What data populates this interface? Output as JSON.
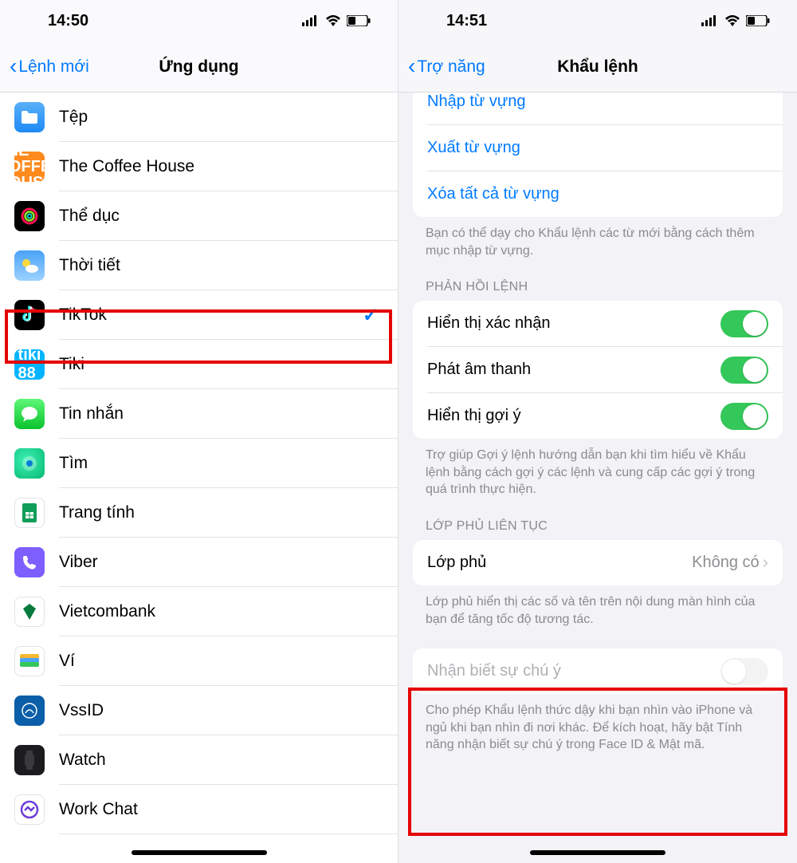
{
  "left": {
    "time": "14:50",
    "back_label": "Lệnh mới",
    "title": "Ứng dụng",
    "apps": [
      {
        "key": "files",
        "label": "Tệp"
      },
      {
        "key": "coffee",
        "label": "The Coffee House"
      },
      {
        "key": "fit",
        "label": "Thể dục"
      },
      {
        "key": "weather",
        "label": "Thời tiết"
      },
      {
        "key": "tiktok",
        "label": "TikTok"
      },
      {
        "key": "tiki",
        "label": "Tiki"
      },
      {
        "key": "msg",
        "label": "Tin nhắn"
      },
      {
        "key": "find",
        "label": "Tìm"
      },
      {
        "key": "sheets",
        "label": "Trang tính"
      },
      {
        "key": "viber",
        "label": "Viber"
      },
      {
        "key": "vcb",
        "label": "Vietcombank"
      },
      {
        "key": "wallet",
        "label": "Ví"
      },
      {
        "key": "vssid",
        "label": "VssID"
      },
      {
        "key": "watch",
        "label": "Watch"
      },
      {
        "key": "workchat",
        "label": "Work Chat"
      }
    ],
    "selected_index": 4
  },
  "right": {
    "time": "14:51",
    "back_label": "Trợ năng",
    "title": "Khẩu lệnh",
    "links": [
      "Nhập từ vựng",
      "Xuất từ vựng",
      "Xóa tất cả từ vựng"
    ],
    "links_footer": "Bạn có thể dạy cho Khẩu lệnh các từ mới bằng cách thêm mục nhập từ vựng.",
    "section_response_header": "PHẢN HỒI LỆNH",
    "toggles": [
      {
        "label": "Hiển thị xác nhận",
        "on": true
      },
      {
        "label": "Phát âm thanh",
        "on": true
      },
      {
        "label": "Hiển thị gợi ý",
        "on": true
      }
    ],
    "toggles_footer": "Trợ giúp Gợi ý lệnh hướng dẫn bạn khi tìm hiểu về Khẩu lệnh bằng cách gợi ý các lệnh và cung cấp các gợi ý trong quá trình thực hiện.",
    "section_overlay_header": "LỚP PHỦ LIÊN TỤC",
    "overlay_label": "Lớp phủ",
    "overlay_value": "Không có",
    "overlay_footer": "Lớp phủ hiển thị các số và tên trên nội dung màn hình của bạn để tăng tốc độ tương tác.",
    "attention_label": "Nhận biết sự chú ý",
    "attention_on": false,
    "attention_footer": "Cho phép Khẩu lệnh thức dậy khi bạn nhìn vào iPhone và ngủ khi bạn nhìn đi nơi khác. Để kích hoạt, hãy bật Tính năng nhận biết sự chú ý trong Face ID & Mật mã."
  }
}
